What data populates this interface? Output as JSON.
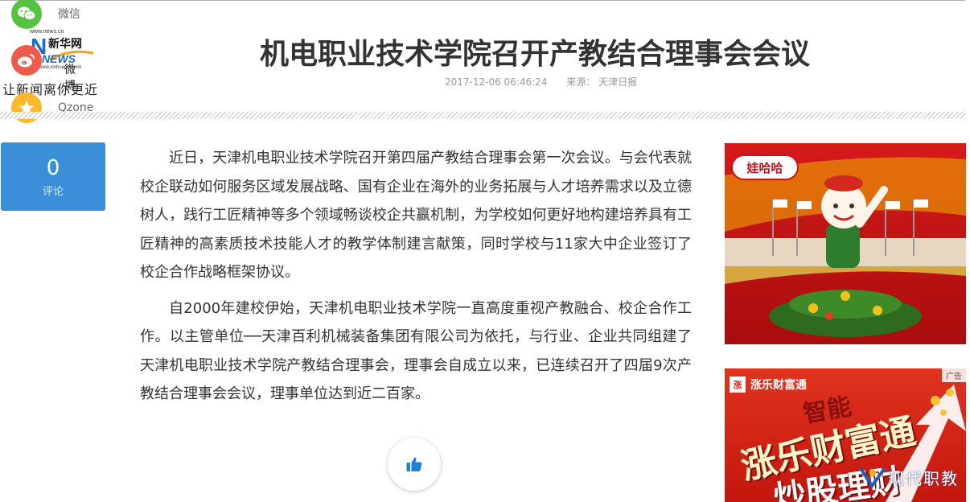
{
  "share": {
    "wechat_label": "微信",
    "weibo_label": "微博",
    "qzone_label": "Qzone"
  },
  "logo": {
    "url_top": "www.news.cn",
    "brand_cn": "新华网",
    "news": "NEWS",
    "url_bottom": "www.xinhuanet.com",
    "slogan": "让新闻离你更近"
  },
  "article": {
    "title": "机电职业技术学院召开产教结合理事会会议",
    "datetime": "2017-12-06 06:46:24",
    "source": "来源： 天津日报",
    "paragraphs": [
      "近日，天津机电职业技术学院召开第四届产教结合理事会第一次会议。与会代表就校企联动如何服务区域发展战略、国有企业在海外的业务拓展与人才培养需求以及立德树人，践行工匠精神等多个领域畅谈校企共赢机制，为学校如何更好地构建培养具有工匠精神的高素质技术技能人才的教学体制建言献策，同时学校与11家大中企业签订了校企合作战略框架协议。",
      "自2000年建校伊始，天津机电职业技术学院一直高度重视产教融合、校企合作工作。以主管单位──天津百利机械装备集团有限公司为依托，与行业、企业共同组建了天津机电职业技术学院产教结合理事会，理事会自成立以来，已连续召开了四届9次产教结合理事会会议，理事单位达到近二百家。"
    ]
  },
  "comments": {
    "count": "0",
    "label": "评论"
  },
  "ads": {
    "ad1_brand": "娃哈哈",
    "ad2_brand": "涨乐财富通",
    "ad2_logo": "涨",
    "ad2_tag": "广告",
    "ad2_line1": "智能",
    "ad2_line2": "涨乐财富通",
    "ad2_line3": "炒股理财"
  },
  "watermark": {
    "text": "现代职教"
  },
  "colors": {
    "comment_box": "#3a8fd8",
    "wechat": "#55c240",
    "weibo": "#f05a4b",
    "qzone": "#fdb92c",
    "ad_red": "#c8151d"
  },
  "icons": {
    "like": "thumbs-up-icon"
  }
}
